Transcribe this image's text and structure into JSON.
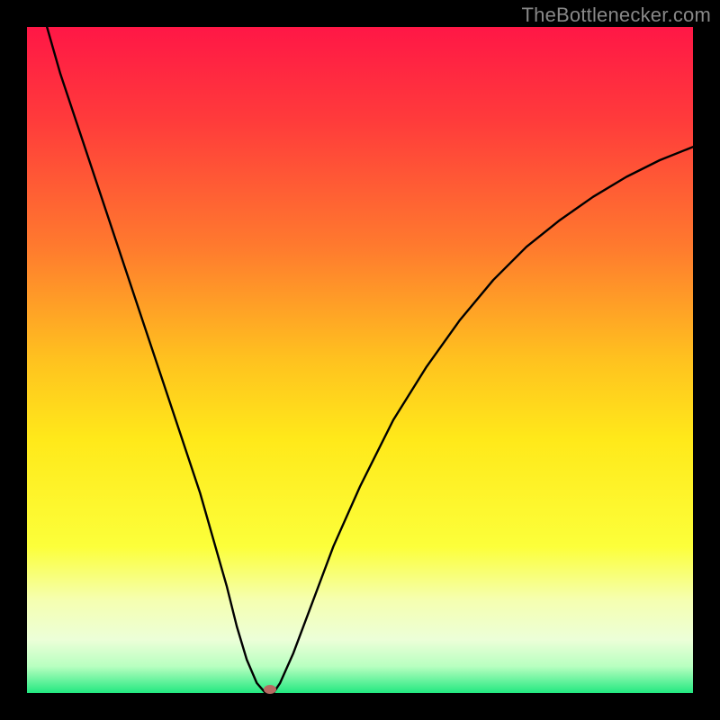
{
  "watermark": "TheBottlenecker.com",
  "chart_data": {
    "type": "line",
    "title": "",
    "xlabel": "",
    "ylabel": "",
    "xlim": [
      0,
      100
    ],
    "ylim": [
      0,
      100
    ],
    "gradient_stops": [
      {
        "offset": 0,
        "color": "#ff1746"
      },
      {
        "offset": 14,
        "color": "#ff3b3b"
      },
      {
        "offset": 33,
        "color": "#ff7a2e"
      },
      {
        "offset": 50,
        "color": "#ffc21f"
      },
      {
        "offset": 62,
        "color": "#ffe91a"
      },
      {
        "offset": 78,
        "color": "#fcff3a"
      },
      {
        "offset": 86,
        "color": "#f5ffb0"
      },
      {
        "offset": 92,
        "color": "#ecffd8"
      },
      {
        "offset": 96,
        "color": "#b8ffc0"
      },
      {
        "offset": 100,
        "color": "#22e880"
      }
    ],
    "series": [
      {
        "name": "bottleneck-curve",
        "x": [
          3,
          5,
          8,
          11,
          14,
          17,
          20,
          23,
          26,
          28,
          30,
          31.5,
          33,
          34.5,
          35.8,
          37,
          38,
          40,
          43,
          46,
          50,
          55,
          60,
          65,
          70,
          75,
          80,
          85,
          90,
          95,
          100
        ],
        "y": [
          100,
          93,
          84,
          75,
          66,
          57,
          48,
          39,
          30,
          23,
          16,
          10,
          5,
          1.5,
          0,
          0,
          1.5,
          6,
          14,
          22,
          31,
          41,
          49,
          56,
          62,
          67,
          71,
          74.5,
          77.5,
          80,
          82
        ]
      }
    ],
    "marker": {
      "x": 36.5,
      "y": 0.5,
      "color": "#b76a62"
    }
  }
}
